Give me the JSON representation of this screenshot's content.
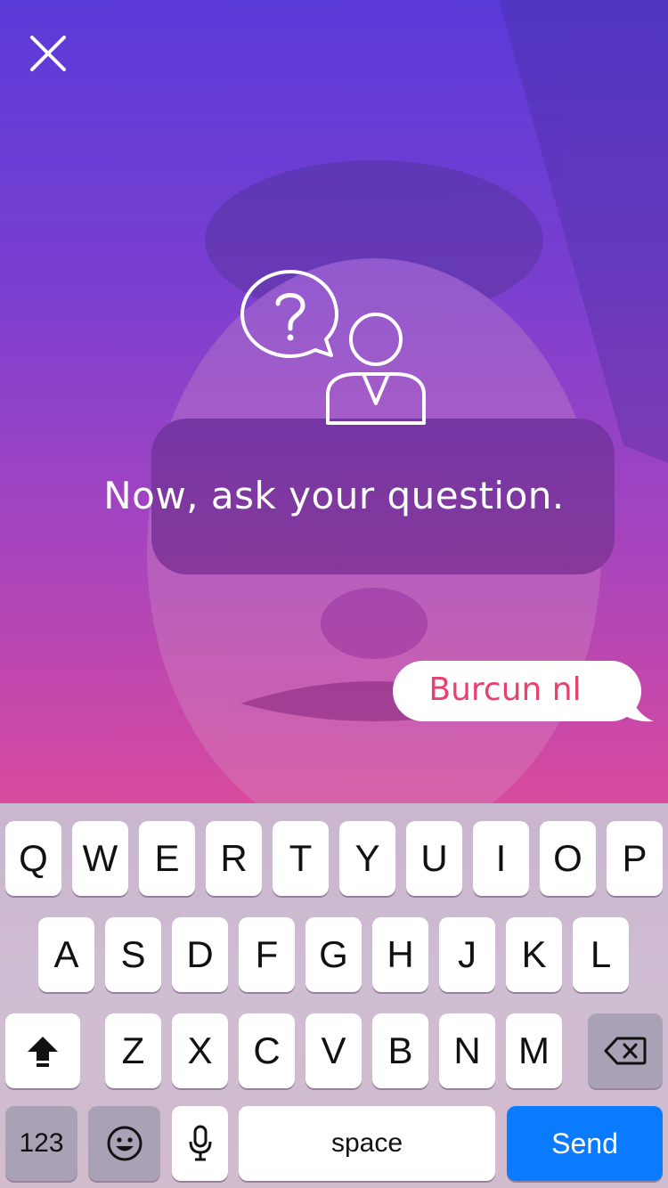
{
  "prompt": {
    "text": "Now, ask your question."
  },
  "message_input": {
    "value": "Burcun nl"
  },
  "keyboard": {
    "row1": [
      "Q",
      "W",
      "E",
      "R",
      "T",
      "Y",
      "U",
      "I",
      "O",
      "P"
    ],
    "row2": [
      "A",
      "S",
      "D",
      "F",
      "G",
      "H",
      "J",
      "K",
      "L"
    ],
    "row3": [
      "Z",
      "X",
      "C",
      "V",
      "B",
      "N",
      "M"
    ],
    "numbers_label": "123",
    "space_label": "space",
    "send_label": "Send"
  },
  "icons": {
    "close": "close-icon",
    "prompt": "question-person-icon",
    "shift": "shift-icon",
    "backspace": "backspace-icon",
    "emoji": "emoji-icon",
    "mic": "microphone-icon"
  },
  "colors": {
    "send": "#0a7bff",
    "bubble_text": "#e8416e"
  }
}
